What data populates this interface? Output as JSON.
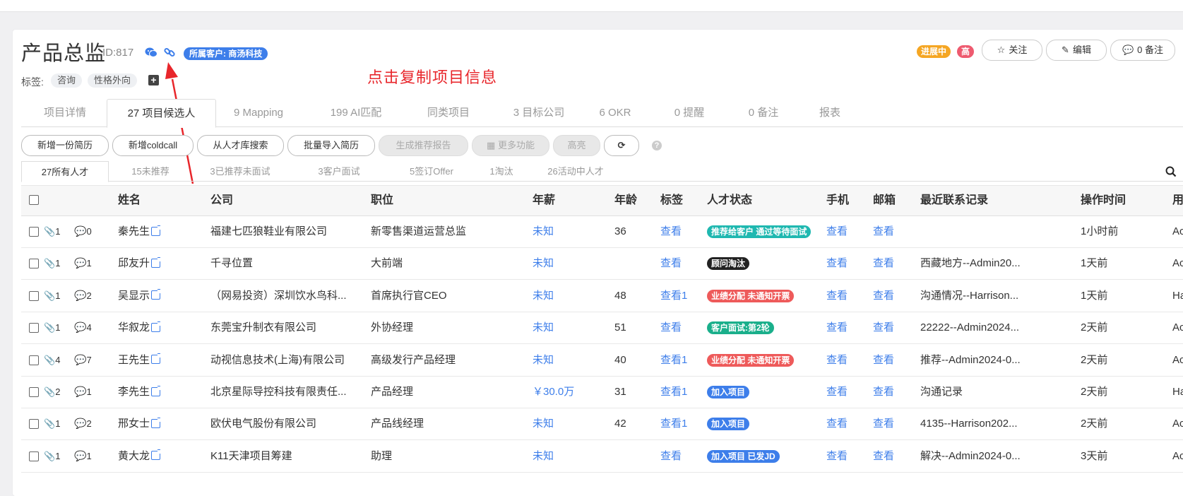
{
  "project": {
    "title": "产品总监",
    "id_label": "ID:817",
    "client_badge": "所属客户: 商汤科技",
    "tags_label": "标签:",
    "tags": [
      "咨询",
      "性格外向"
    ],
    "add_tag": "+",
    "status": "进展中",
    "priority": "高"
  },
  "annotation": "点击复制项目信息",
  "header_buttons": {
    "follow": "关注",
    "edit": "编辑",
    "notes": "0 备注"
  },
  "tabs": [
    "项目详情",
    "27 项目候选人",
    "9 Mapping",
    "199 AI匹配",
    "同类项目",
    "3 目标公司",
    "6 OKR",
    "0 提醒",
    "0 备注",
    "报表"
  ],
  "actions": [
    "新增一份简历",
    "新增coldcall",
    "从人才库搜索",
    "批量导入简历",
    "生成推荐报告",
    "更多功能",
    "高亮"
  ],
  "help": "?",
  "subtabs": [
    "27所有人才",
    "15未推荐",
    "3已推荐未面试",
    "3客户面试",
    "5签订Offer",
    "1淘汰",
    "26活动中人才"
  ],
  "columns": [
    "姓名",
    "公司",
    "职位",
    "年薪",
    "年龄",
    "标签",
    "人才状态",
    "手机",
    "邮箱",
    "最近联系记录",
    "操作时间",
    "用"
  ],
  "rows": [
    {
      "att": "1",
      "cmt": "0",
      "name": "秦先生",
      "company": "福建七匹狼鞋业有限公司",
      "position": "新零售渠道运营总监",
      "salary": "未知",
      "age": "36",
      "tag": "查看",
      "status": "推荐给客户 通过等待面试",
      "status_color": "#1fb8b0",
      "phone": "查看",
      "email": "查看",
      "contact": "",
      "time": "1小时前",
      "user": "Ac"
    },
    {
      "att": "1",
      "cmt": "1",
      "name": "邱友升",
      "company": "千寻位置",
      "position": "大前端",
      "salary": "未知",
      "age": "",
      "tag": "查看",
      "status": "顾问淘汰",
      "status_color": "#222222",
      "phone": "查看",
      "email": "查看",
      "contact": "西藏地方--Admin20...",
      "time": "1天前",
      "user": "Ac"
    },
    {
      "att": "1",
      "cmt": "2",
      "name": "吴显示",
      "company": "（网易投资）深圳饮水鸟科...",
      "position": "首席执行官CEO",
      "salary": "未知",
      "age": "48",
      "tag": "查看1",
      "status": "业绩分配 未通知开票",
      "status_color": "#ee5a5a",
      "phone": "查看",
      "email": "查看",
      "contact": "沟通情况--Harrison...",
      "time": "1天前",
      "user": "Ha"
    },
    {
      "att": "1",
      "cmt": "4",
      "name": "华叙龙",
      "company": "东莞宝升制衣有限公司",
      "position": "外协经理",
      "salary": "未知",
      "age": "51",
      "tag": "查看",
      "status": "客户面试:第2轮",
      "status_color": "#1aaf8b",
      "phone": "查看",
      "email": "查看",
      "contact": "22222--Admin2024...",
      "time": "2天前",
      "user": "Ac"
    },
    {
      "att": "4",
      "cmt": "7",
      "name": "王先生",
      "company": "动视信息技术(上海)有限公司",
      "position": "高级发行产品经理",
      "salary": "未知",
      "age": "40",
      "tag": "查看1",
      "status": "业绩分配 未通知开票",
      "status_color": "#ee5a5a",
      "phone": "查看",
      "email": "查看",
      "contact": "推荐--Admin2024-0...",
      "time": "2天前",
      "user": "Ac"
    },
    {
      "att": "2",
      "cmt": "1",
      "name": "李先生",
      "company": "北京星际导控科技有限责任...",
      "position": "产品经理",
      "salary": "￥30.0万",
      "age": "31",
      "tag": "查看1",
      "status": "加入项目",
      "status_color": "#3d7eea",
      "phone": "查看",
      "email": "查看",
      "contact": "沟通记录",
      "time": "2天前",
      "user": "Ha"
    },
    {
      "att": "1",
      "cmt": "2",
      "name": "邢女士",
      "company": "欧伏电气股份有限公司",
      "position": "产品线经理",
      "salary": "未知",
      "age": "42",
      "tag": "查看1",
      "status": "加入项目",
      "status_color": "#3d7eea",
      "phone": "查看",
      "email": "查看",
      "contact": "4135--Harrison202...",
      "time": "2天前",
      "user": "Ac"
    },
    {
      "att": "1",
      "cmt": "1",
      "name": "黄大龙",
      "company": "K11天津项目筹建",
      "position": "助理",
      "salary": "未知",
      "age": "",
      "tag": "查看",
      "status": "加入项目 已发JD",
      "status_color": "#3d7eea",
      "phone": "查看",
      "email": "查看",
      "contact": "解决--Admin2024-0...",
      "time": "3天前",
      "user": "Ac"
    }
  ],
  "colors": {
    "accent": "#3d7eea",
    "status_orange": "#f5a623",
    "priority_red": "#ee5a6f",
    "annotation_red": "#e8262b"
  }
}
